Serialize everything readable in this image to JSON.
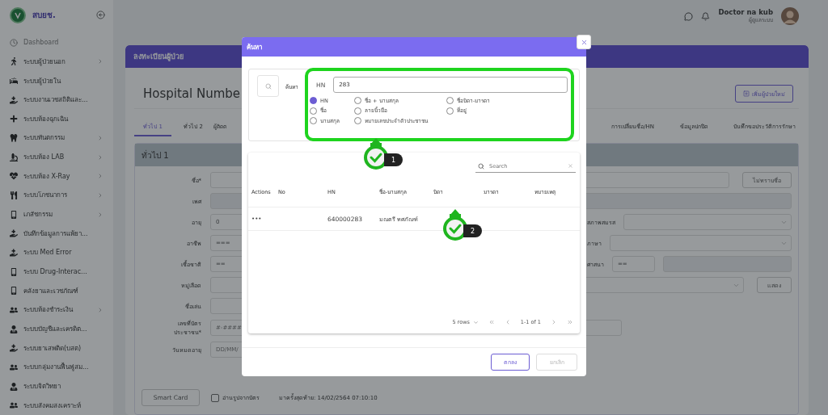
{
  "sidebar": {
    "logo": "สบยช.",
    "items": [
      {
        "label": "Dashboard",
        "expandable": false
      },
      {
        "label": "ระบบผู้ป่วยนอก",
        "expandable": true
      },
      {
        "label": "ระบบผู้ป่วยใน",
        "expandable": false
      },
      {
        "label": "ระบบงานเวชสถิติและ...",
        "expandable": false
      },
      {
        "label": "ระบบห้องฉุกเฉิน",
        "expandable": false
      },
      {
        "label": "ระบบทันตกรรม",
        "expandable": true
      },
      {
        "label": "ระบบห้อง LAB",
        "expandable": true
      },
      {
        "label": "ระบบห้อง X-Ray",
        "expandable": true
      },
      {
        "label": "ระบบโภชนาการ",
        "expandable": true
      },
      {
        "label": "เภสัชกรรม",
        "expandable": true
      },
      {
        "label": "บันทึกข้อมูลการแพ้ยา...",
        "expandable": false
      },
      {
        "label": "ระบบ Med Error",
        "expandable": false
      },
      {
        "label": "ระบบ Drug-Interac...",
        "expandable": false
      },
      {
        "label": "คลังยาและเวชภัณฑ์",
        "expandable": false
      },
      {
        "label": "ระบบห้องชำระเงิน",
        "expandable": true
      },
      {
        "label": "ระบบบัญชีและเครดิต...",
        "expandable": false
      },
      {
        "label": "ระบบยาเสพติด(บสต)",
        "expandable": false
      },
      {
        "label": "ระบบกลุ่มงานฟื้นฟูสม...",
        "expandable": false
      },
      {
        "label": "ระบบจิตวิทยา",
        "expandable": false
      },
      {
        "label": "ระบบสังคมสงเคราะห์",
        "expandable": false
      }
    ]
  },
  "header": {
    "user_name": "Doctor na kub",
    "user_role": "ผู้ดูแลระบบ"
  },
  "page": {
    "banner": "ลงทะเบียนผู้ป่วย",
    "title": "Hospital Numbe",
    "add_button": "เพิ่มผู้ป่วยใหม่",
    "tabs_left": [
      {
        "label": "ทั่วไป 1",
        "selected": true
      },
      {
        "label": "ทั่วไป 2",
        "selected": false
      },
      {
        "label": "ผู้ติดต",
        "selected": false
      }
    ],
    "tabs_right": [
      {
        "label": "การเปลี่ยนชื่อ/HN",
        "selected": false
      },
      {
        "label": "ข้อมูลปกปิด",
        "selected": false
      },
      {
        "label": "บันทึกขอประวัติการรักษา",
        "selected": false
      }
    ],
    "section_title": "ทั่วไป 1",
    "form_rows": [
      {
        "label": "ชื่อ*",
        "kind": "name",
        "button": "ไม่ทราบชื่อ"
      },
      {
        "label": "เพศ",
        "kind": "wide"
      },
      {
        "label": "อายุ",
        "kind": "split",
        "value": "0",
        "right": {
          "label": "สภาพสมรส",
          "kind": "select"
        }
      },
      {
        "label": "อาชีพ",
        "kind": "split",
        "value": "===",
        "right": {
          "label": "ภาษา",
          "kind": "select"
        }
      },
      {
        "label": "เชื้อชาติ",
        "kind": "split",
        "value": "==",
        "right": {
          "label": "ศาสนา",
          "kind": "code",
          "value": "=="
        }
      },
      {
        "label": "หมู่เลือด",
        "kind": "select_button",
        "button": "แสดง"
      },
      {
        "label": "ชื่อเล่น",
        "kind": "short"
      },
      {
        "label": "เลขที่บัตรประชาชน*",
        "kind": "medium",
        "placeholder": "#-####-"
      },
      {
        "label": "วันหมดอายุ",
        "kind": "short",
        "placeholder": "DD/MM/"
      }
    ],
    "smart_card_button": "Smart Card",
    "read_photo": {
      "label": "อ่านรูปจากบัตร",
      "checked": false
    },
    "last_visit": "มาครั้งสุดท้าย: 14/02/2564 07:10:10"
  },
  "dialog": {
    "title": "ค้นหา",
    "search_label": "ค้นหา",
    "field_label": "HN",
    "field_value": "283",
    "options": [
      {
        "label": "HN",
        "selected": true
      },
      {
        "label": "ชื่อ + นามสกุล",
        "selected": false
      },
      {
        "label": "ชื่อบิดา-มารดา",
        "selected": false
      },
      {
        "label": "ชื่อ",
        "selected": false
      },
      {
        "label": "ลายนิ้วมือ",
        "selected": false
      },
      {
        "label": "ที่อยู่",
        "selected": false
      },
      {
        "label": "นามสกุล",
        "selected": false
      },
      {
        "label": "หมายเลขประจำตัวประชาชน",
        "selected": false
      }
    ],
    "table": {
      "search_placeholder": "Search",
      "columns": [
        "Actions",
        "No",
        "HN",
        "ชื่อ-นามสกุล",
        "บิดา",
        "มารดา",
        "หมายเหตุ"
      ],
      "rows": [
        {
          "actions": "•••",
          "hn": "640000283",
          "name": "มณตรี ทศภัณฑ์"
        }
      ],
      "rows_per_page": "5 rows",
      "range": "1-1 of 1"
    },
    "ok_button": "ตกลง",
    "cancel_button": {
      "label": "ยกเลิก",
      "disabled": true
    }
  },
  "annotations": [
    {
      "number": "1"
    },
    {
      "number": "2"
    }
  ]
}
